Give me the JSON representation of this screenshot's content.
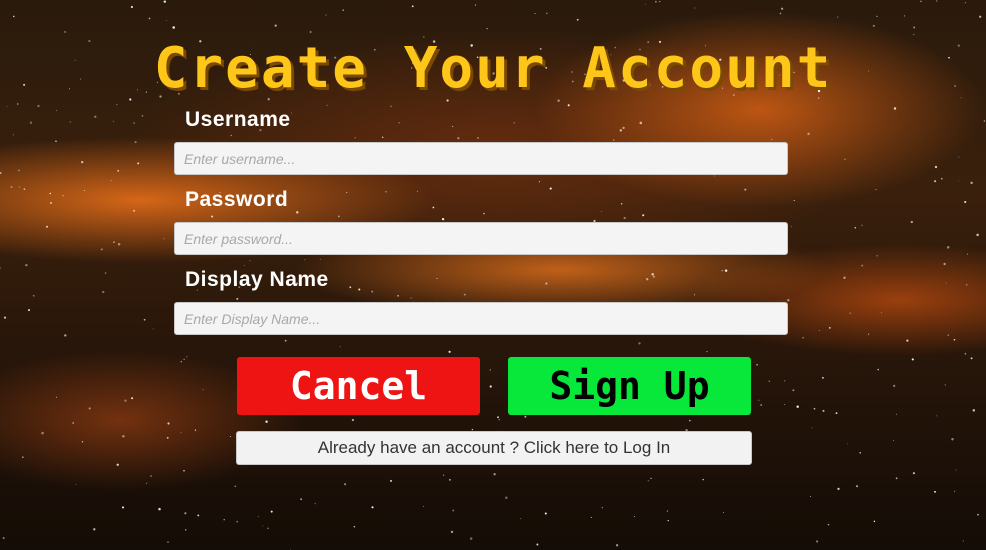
{
  "header": {
    "title": "Create Your Account"
  },
  "form": {
    "username": {
      "label": "Username",
      "value": "",
      "placeholder": "Enter username..."
    },
    "password": {
      "label": "Password",
      "value": "",
      "placeholder": "Enter password..."
    },
    "display_name": {
      "label": "Display Name",
      "value": "",
      "placeholder": "Enter Display Name..."
    }
  },
  "actions": {
    "cancel_label": "Cancel",
    "signup_label": "Sign Up",
    "login_link_label": "Already have an account ? Click here to Log In"
  },
  "colors": {
    "title": "#ffc61a",
    "cancel_button": "#ee1414",
    "signup_button": "#08e83a",
    "input_background": "#f4f4f4"
  }
}
